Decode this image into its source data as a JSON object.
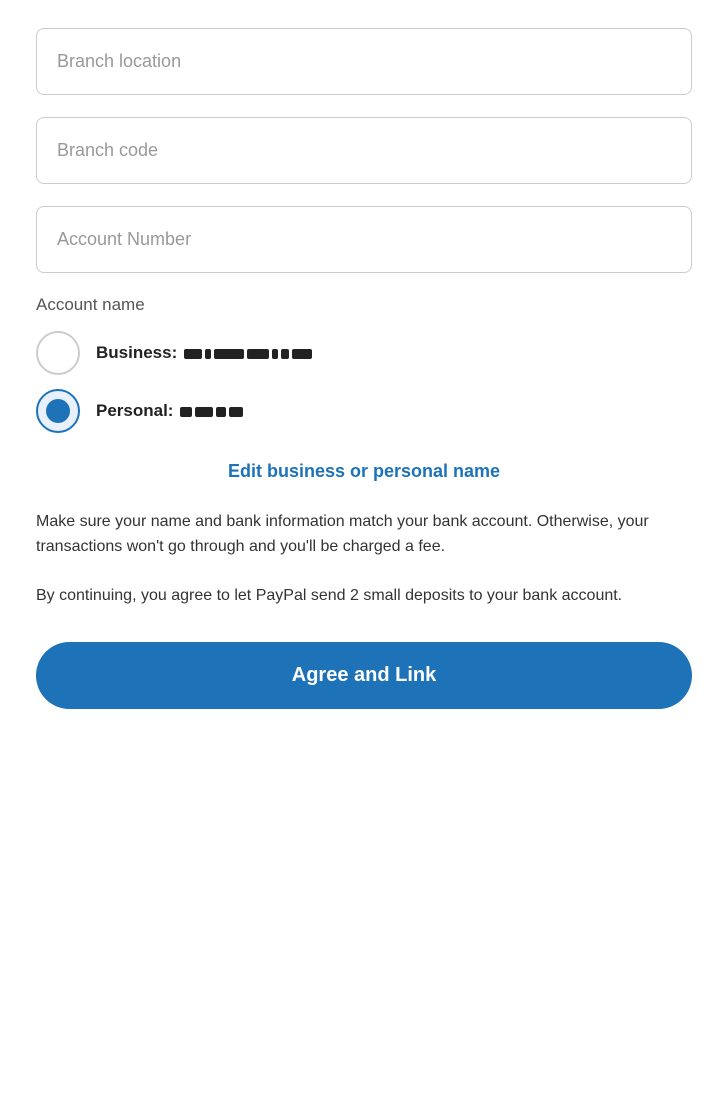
{
  "form": {
    "branch_location_placeholder": "Branch location",
    "branch_code_placeholder": "Branch code",
    "account_number_placeholder": "Account Number",
    "account_name_label": "Account name"
  },
  "radio_options": [
    {
      "id": "business",
      "label_bold": "Business:",
      "label_value": "business_blurred",
      "selected": false
    },
    {
      "id": "personal",
      "label_bold": "Personal:",
      "label_value": "personal_blurred",
      "selected": true
    }
  ],
  "edit_link": "Edit business or personal name",
  "info_text_1": "Make sure your name and bank information match your bank account. Otherwise, your transactions won't go through and you'll be charged a fee.",
  "info_text_2": "By continuing, you agree to let PayPal send 2 small deposits to your bank account.",
  "agree_button_label": "Agree and Link",
  "colors": {
    "primary_blue": "#1d72b8",
    "border_gray": "#cccccc",
    "text_gray": "#999999"
  }
}
